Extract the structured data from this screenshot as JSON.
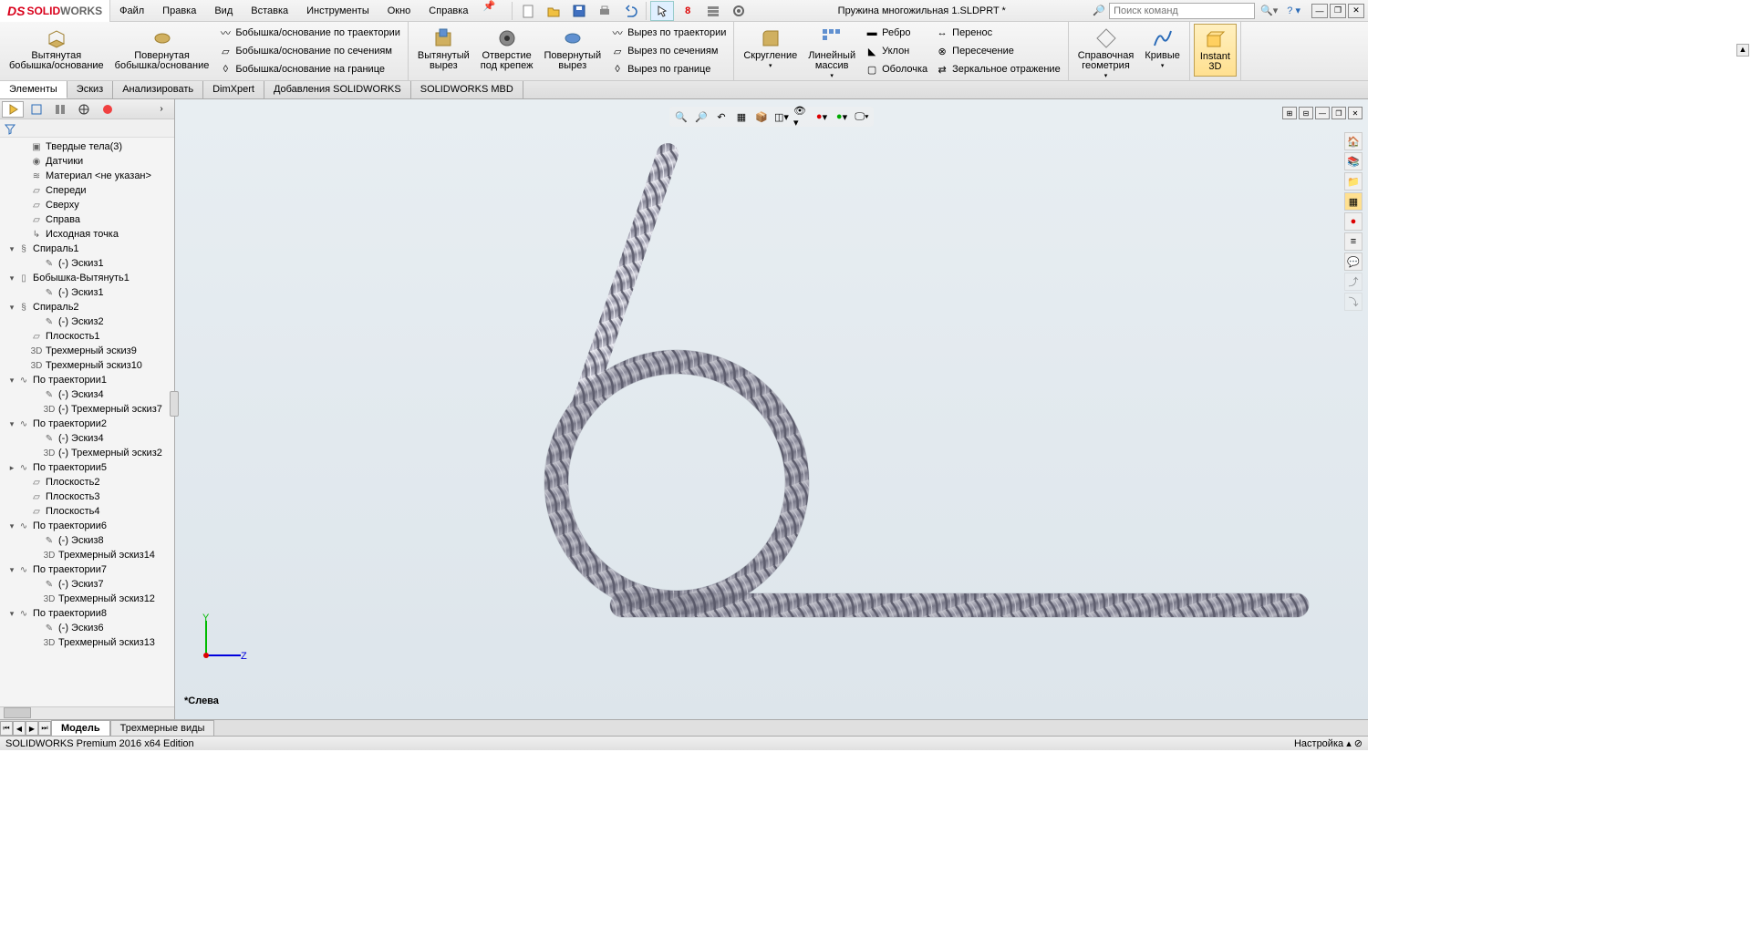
{
  "app": {
    "logo_ds": "DS",
    "logo_solid": "SOLID",
    "logo_works": "WORKS"
  },
  "menus": [
    "Файл",
    "Правка",
    "Вид",
    "Вставка",
    "Инструменты",
    "Окно",
    "Справка"
  ],
  "title": "Пружина многожильная 1.SLDPRT *",
  "search_placeholder": "Поиск команд",
  "ribbon": {
    "extrude": "Вытянутая\nбобышка/основание",
    "revolve": "Повернутая\nбобышка/основание",
    "sweep": "Бобышка/основание по траектории",
    "loft": "Бобышка/основание по сечениям",
    "boundary": "Бобышка/основание на границе",
    "cut_extrude": "Вытянутый\nвырез",
    "hole": "Отверстие\nпод крепеж",
    "cut_revolve": "Повернутый\nвырез",
    "cut_sweep": "Вырез по траектории",
    "cut_loft": "Вырез по сечениям",
    "cut_boundary": "Вырез по границе",
    "fillet": "Скругление",
    "pattern": "Линейный\nмассив",
    "rib": "Ребро",
    "draft": "Уклон",
    "shell": "Оболочка",
    "move": "Перенос",
    "intersect": "Пересечение",
    "mirror": "Зеркальное отражение",
    "refgeom": "Справочная\nгеометрия",
    "curves": "Кривые",
    "instant3d": "Instant\n3D"
  },
  "tabs": [
    "Элементы",
    "Эскиз",
    "Анализировать",
    "DimXpert",
    "Добавления SOLIDWORKS",
    "SOLIDWORKS MBD"
  ],
  "tree": [
    {
      "l": 1,
      "t": "",
      "i": "cube",
      "x": "Твердые тела(3)"
    },
    {
      "l": 1,
      "t": "",
      "i": "sensor",
      "x": "Датчики"
    },
    {
      "l": 1,
      "t": "",
      "i": "mat",
      "x": "Материал <не указан>"
    },
    {
      "l": 1,
      "t": "",
      "i": "plane",
      "x": "Спереди"
    },
    {
      "l": 1,
      "t": "",
      "i": "plane",
      "x": "Сверху"
    },
    {
      "l": 1,
      "t": "",
      "i": "plane",
      "x": "Справа"
    },
    {
      "l": 1,
      "t": "",
      "i": "origin",
      "x": "Исходная точка"
    },
    {
      "l": 0,
      "t": "▾",
      "i": "helix",
      "x": "Спираль1"
    },
    {
      "l": 2,
      "t": "",
      "i": "sk",
      "x": "(-) Эскиз1"
    },
    {
      "l": 0,
      "t": "▾",
      "i": "ext",
      "x": "Бобышка-Вытянуть1"
    },
    {
      "l": 2,
      "t": "",
      "i": "sk",
      "x": "(-) Эскиз1"
    },
    {
      "l": 0,
      "t": "▾",
      "i": "helix",
      "x": "Спираль2"
    },
    {
      "l": 2,
      "t": "",
      "i": "sk",
      "x": "(-) Эскиз2"
    },
    {
      "l": 1,
      "t": "",
      "i": "plane",
      "x": "Плоскость1"
    },
    {
      "l": 1,
      "t": "",
      "i": "3d",
      "x": "Трехмерный эскиз9"
    },
    {
      "l": 1,
      "t": "",
      "i": "3d",
      "x": "Трехмерный эскиз10"
    },
    {
      "l": 0,
      "t": "▾",
      "i": "swp",
      "x": "По траектории1"
    },
    {
      "l": 2,
      "t": "",
      "i": "sk",
      "x": "(-) Эскиз4"
    },
    {
      "l": 2,
      "t": "",
      "i": "3d",
      "x": "(-) Трехмерный эскиз7"
    },
    {
      "l": 0,
      "t": "▾",
      "i": "swp",
      "x": "По траектории2"
    },
    {
      "l": 2,
      "t": "",
      "i": "sk",
      "x": "(-) Эскиз4"
    },
    {
      "l": 2,
      "t": "",
      "i": "3d",
      "x": "(-) Трехмерный эскиз2"
    },
    {
      "l": 0,
      "t": "▸",
      "i": "swp",
      "x": "По траектории5"
    },
    {
      "l": 1,
      "t": "",
      "i": "plane",
      "x": "Плоскость2"
    },
    {
      "l": 1,
      "t": "",
      "i": "plane",
      "x": "Плоскость3"
    },
    {
      "l": 1,
      "t": "",
      "i": "plane",
      "x": "Плоскость4"
    },
    {
      "l": 0,
      "t": "▾",
      "i": "swp",
      "x": "По траектории6"
    },
    {
      "l": 2,
      "t": "",
      "i": "sk",
      "x": "(-) Эскиз8"
    },
    {
      "l": 2,
      "t": "",
      "i": "3d",
      "x": "Трехмерный эскиз14"
    },
    {
      "l": 0,
      "t": "▾",
      "i": "swp",
      "x": "По траектории7"
    },
    {
      "l": 2,
      "t": "",
      "i": "sk",
      "x": "(-) Эскиз7"
    },
    {
      "l": 2,
      "t": "",
      "i": "3d",
      "x": "Трехмерный эскиз12"
    },
    {
      "l": 0,
      "t": "▾",
      "i": "swp",
      "x": "По траектории8"
    },
    {
      "l": 2,
      "t": "",
      "i": "sk",
      "x": "(-) Эскиз6"
    },
    {
      "l": 2,
      "t": "",
      "i": "3d",
      "x": "Трехмерный эскиз13"
    }
  ],
  "view_label": "*Слева",
  "bottom_tabs": [
    "Модель",
    "Трехмерные виды"
  ],
  "status_left": "SOLIDWORKS Premium 2016 x64 Edition",
  "status_right": "Настройка"
}
